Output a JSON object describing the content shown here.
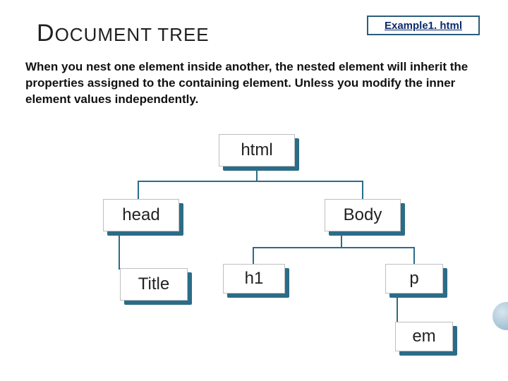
{
  "header": {
    "title_pre": "D",
    "title_rest": "OCUMENT TREE",
    "example_label": "Example1. html"
  },
  "body_text": "When you nest one element inside another, the nested element will inherit the properties assigned to the containing element. Unless you modify the inner element values independently.",
  "tree": {
    "root": "html",
    "level2": {
      "left": "head",
      "right": "Body"
    },
    "level3": {
      "title": "Title",
      "h1": "h1",
      "p": "p"
    },
    "level4": {
      "em": "em"
    }
  }
}
